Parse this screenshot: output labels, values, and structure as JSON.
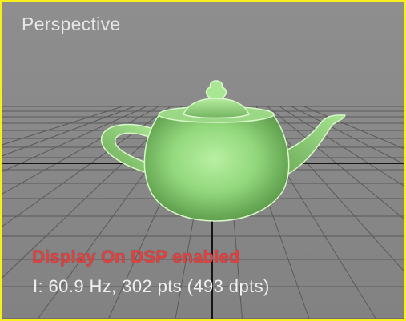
{
  "viewport": {
    "label": "Perspective",
    "status_message": "Display On DSP enabled",
    "stats": "I: 60.9 Hz, 302 pts (493 dpts)",
    "active_border_color": "#f7ee1b",
    "status_color": "#e23f3f"
  },
  "scene": {
    "object": "teapot",
    "object_color": "#8fd07a",
    "background_color": "#8a8a8a",
    "grid_color": "#5a5a5a",
    "axis_color": "#151515"
  }
}
